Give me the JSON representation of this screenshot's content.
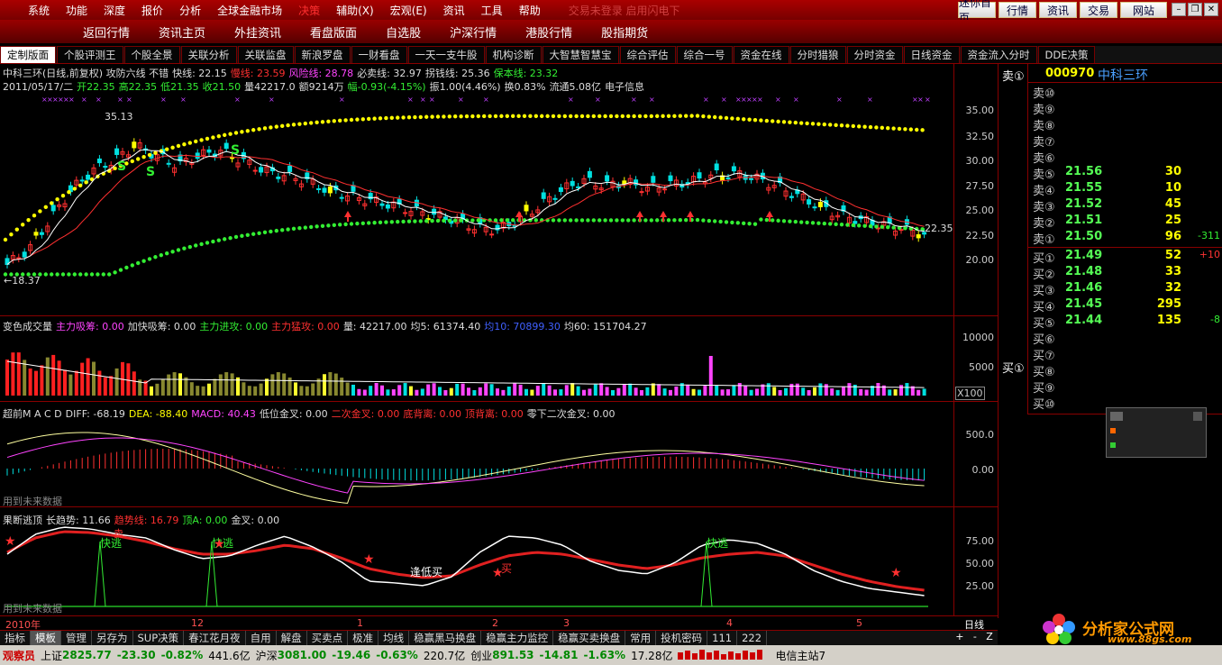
{
  "menu": {
    "items": [
      "系统",
      "功能",
      "深度",
      "报价",
      "分析",
      "全球金融市场",
      "决策",
      "辅助(X)",
      "宏观(E)",
      "资讯",
      "工具",
      "帮助"
    ],
    "marquee": "交易未登录  启用闪电下",
    "right_buttons": [
      "迷你首页",
      "行情",
      "资讯",
      "交易",
      "网站"
    ],
    "window_controls": [
      "–",
      "❐",
      "✕"
    ]
  },
  "nav": {
    "items": [
      "返回行情",
      "资讯主页",
      "外挂资讯",
      "看盘版面",
      "自选股",
      "沪深行情",
      "港股行情",
      "股指期货"
    ]
  },
  "tabs": [
    "定制版面",
    "个股评测王",
    "个股全景",
    "关联分析",
    "关联监盘",
    "新浪罗盘",
    "一财看盘",
    "一天一支牛股",
    "机构诊断",
    "大智慧智慧宝",
    "综合评估",
    "综合一号",
    "资金在线",
    "分时猎狼",
    "分时资金",
    "日线资金",
    "资金流入分时",
    "DDE决策"
  ],
  "colors": {
    "up": "#ff3030",
    "down": "#00e0e0",
    "yellow": "#ffff00",
    "green": "#33ee33",
    "accent": "#cc0000"
  },
  "main": {
    "row1": [
      {
        "t": "中科三环(日线,前复权) 攻防六线 不错",
        "c": "#dddddd"
      },
      {
        "t": "快线: 22.15",
        "c": "#dddddd"
      },
      {
        "t": "慢线: 23.59",
        "c": "#ff3030"
      },
      {
        "t": "风险线: 28.78",
        "c": "#ff44ff"
      },
      {
        "t": "必卖线: 32.97",
        "c": "#dddddd"
      },
      {
        "t": "拐钱线: 25.36",
        "c": "#dddddd"
      },
      {
        "t": "保本线: 23.32",
        "c": "#33ee33"
      }
    ],
    "row2": [
      {
        "t": "2011/05/17/二",
        "c": "#dddddd"
      },
      {
        "t": "开22.35",
        "c": "#33ee33"
      },
      {
        "t": "高22.35",
        "c": "#33ee33"
      },
      {
        "t": "低21.35",
        "c": "#33ee33"
      },
      {
        "t": "收21.50",
        "c": "#33ee33"
      },
      {
        "t": "量42217.0",
        "c": "#dddddd"
      },
      {
        "t": "额9214万",
        "c": "#dddddd"
      },
      {
        "t": "幅-0.93(-4.15%)",
        "c": "#33ee33"
      },
      {
        "t": "振1.00(4.46%)",
        "c": "#dddddd"
      },
      {
        "t": "换0.83%",
        "c": "#dddddd"
      },
      {
        "t": "流通5.08亿",
        "c": "#dddddd"
      },
      {
        "t": "电子信息",
        "c": "#dddddd"
      }
    ],
    "y_labels": [
      "35.00",
      "32.50",
      "30.00",
      "27.50",
      "25.00",
      "22.50",
      "20.00"
    ],
    "hi_label": "35.13",
    "lo_label": "←18.37",
    "last_label": "22.35",
    "s_marks": [
      "S",
      "S",
      "S"
    ]
  },
  "volume": {
    "row": [
      {
        "t": "变色成交量",
        "c": "#dddddd"
      },
      {
        "t": "主力吸筹: 0.00",
        "c": "#ff44ff"
      },
      {
        "t": "加快吸筹: 0.00",
        "c": "#dddddd"
      },
      {
        "t": "主力进攻: 0.00",
        "c": "#33ee33"
      },
      {
        "t": "主力猛攻: 0.00",
        "c": "#ff3030"
      },
      {
        "t": "量: 42217.00",
        "c": "#dddddd"
      },
      {
        "t": "均5: 61374.40",
        "c": "#dddddd"
      },
      {
        "t": "均10: 70899.30",
        "c": "#4060ff"
      },
      {
        "t": "均60: 151704.27",
        "c": "#dddddd"
      }
    ],
    "y_labels": [
      "10000",
      "5000"
    ],
    "unit": "X100"
  },
  "macd": {
    "row": [
      {
        "t": "超前M A C D",
        "c": "#dddddd"
      },
      {
        "t": "DIFF: -68.19",
        "c": "#dddddd"
      },
      {
        "t": "DEA: -88.40",
        "c": "#ffff00"
      },
      {
        "t": "MACD: 40.43",
        "c": "#ff44ff"
      },
      {
        "t": "低位金叉: 0.00",
        "c": "#dddddd"
      },
      {
        "t": "二次金叉: 0.00",
        "c": "#ff3030"
      },
      {
        "t": "底背离: 0.00",
        "c": "#ff3030"
      },
      {
        "t": "顶背离: 0.00",
        "c": "#ff3030"
      },
      {
        "t": "零下二次金叉: 0.00",
        "c": "#dddddd"
      }
    ],
    "y_labels": [
      "500.0",
      "0.00"
    ],
    "note": "用到未来数据"
  },
  "escape": {
    "row": [
      {
        "t": "果断逃顶",
        "c": "#dddddd"
      },
      {
        "t": "长趋势: 11.66",
        "c": "#dddddd"
      },
      {
        "t": "趋势线: 16.79",
        "c": "#ff3030"
      },
      {
        "t": "顶A: 0.00",
        "c": "#33ee33"
      },
      {
        "t": "金叉: 0.00",
        "c": "#dddddd"
      }
    ],
    "y_labels": [
      "75.00",
      "50.00",
      "25.00"
    ],
    "note": "用到未来数据",
    "labels": {
      "fast1": "快逃",
      "fast2": "快逃",
      "fast3": "快逃",
      "dibuy": "逢低买",
      "buy": "买",
      "sell": "卖"
    }
  },
  "xaxis": {
    "labels": [
      "2010年",
      "12",
      "1",
      "2",
      "3",
      "4",
      "5"
    ],
    "period": "日线"
  },
  "bottom_tabs": [
    "指标",
    "模板",
    "管理",
    "另存为",
    "SUP决策",
    "春江花月夜",
    "自用",
    "解盘",
    "买卖点",
    "极准",
    "均线",
    "稳赢黑马换盘",
    "稳赢主力监控",
    "稳赢买卖换盘",
    "常用",
    "投机密码",
    "111",
    "222"
  ],
  "bottom_nav": [
    "+",
    "-",
    "Z"
  ],
  "book": {
    "side_sell": "卖①",
    "side_buy": "买①",
    "code": "000970",
    "name": "中科三环",
    "sell_labels": [
      "卖⑩",
      "卖⑨",
      "卖⑧",
      "卖⑦",
      "卖⑥",
      "卖⑤",
      "卖④",
      "卖③",
      "卖②",
      "卖①"
    ],
    "sells": [
      {
        "p": "",
        "v": ""
      },
      {
        "p": "",
        "v": ""
      },
      {
        "p": "",
        "v": ""
      },
      {
        "p": "",
        "v": ""
      },
      {
        "p": "",
        "v": ""
      },
      {
        "p": "21.56",
        "v": "30"
      },
      {
        "p": "21.55",
        "v": "10"
      },
      {
        "p": "21.52",
        "v": "45"
      },
      {
        "p": "21.51",
        "v": "25"
      },
      {
        "p": "21.50",
        "v": "96",
        "c": "-311"
      }
    ],
    "buy_labels": [
      "买①",
      "买②",
      "买③",
      "买④",
      "买⑤",
      "买⑥",
      "买⑦",
      "买⑧",
      "买⑨",
      "买⑩"
    ],
    "buys": [
      {
        "p": "21.49",
        "v": "52",
        "c": "+10"
      },
      {
        "p": "21.48",
        "v": "33"
      },
      {
        "p": "21.46",
        "v": "32"
      },
      {
        "p": "21.45",
        "v": "295"
      },
      {
        "p": "21.44",
        "v": "135",
        "c": "-8"
      },
      {
        "p": "",
        "v": ""
      },
      {
        "p": "",
        "v": ""
      },
      {
        "p": "",
        "v": ""
      },
      {
        "p": "",
        "v": ""
      },
      {
        "p": "",
        "v": ""
      }
    ]
  },
  "brand": {
    "name": "分析家公式网",
    "url": "www.88gs.com"
  },
  "status": {
    "observer": "观察员",
    "sh_label": "上证",
    "sh": "2825.77",
    "sh_chg": "-23.30",
    "sh_pct": "-0.82%",
    "sh_amt": "441.6亿",
    "hs_label": "沪深",
    "hs": "3081.00",
    "hs_chg": "-19.46",
    "hs_pct": "-0.63%",
    "hs_amt": "220.7亿",
    "cy_label": "创业",
    "cy": "891.53",
    "cy_chg": "-14.81",
    "cy_pct": "-1.63%",
    "cy_amt": "17.28亿",
    "server": "电信主站7"
  }
}
